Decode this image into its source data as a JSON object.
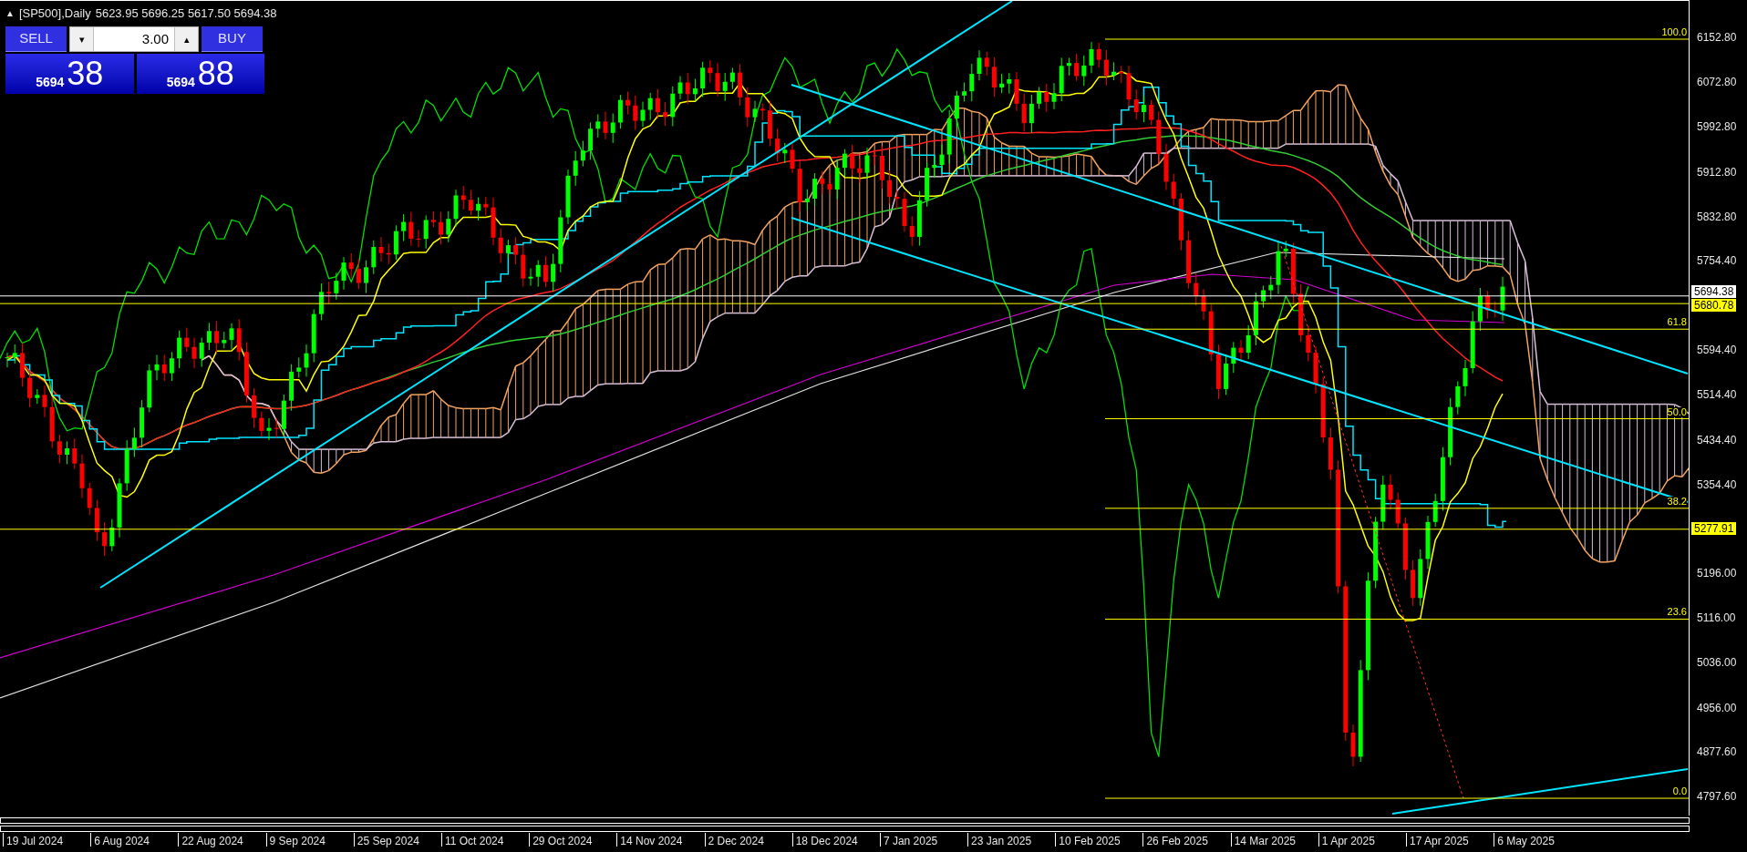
{
  "chart_header": {
    "collapse_glyph": "▲",
    "title": "[SP500],Daily",
    "ohlc": "5623.95 5696.25 5617.50 5694.38"
  },
  "trade_panel": {
    "sell_label": "SELL",
    "buy_label": "BUY",
    "volume": {
      "down_glyph": "▾",
      "value": "3.00",
      "up_glyph": "▴"
    },
    "sell_price": {
      "big_figure": "5694",
      "pips": "38"
    },
    "buy_price": {
      "big_figure": "5694",
      "pips": "88"
    }
  },
  "fibonacci_levels": [
    "100.0",
    "61.8",
    "50.0",
    "38.2",
    "23.6",
    "0.0"
  ],
  "price_axis": [
    "6152.80",
    "6072.80",
    "5992.80",
    "5912.80",
    "5832.80",
    "5754.40",
    "5594.40",
    "5514.40",
    "5434.40",
    "5354.40",
    "5196.00",
    "5116.00",
    "5036.00",
    "4956.00",
    "4877.60",
    "4797.60"
  ],
  "price_tags": [
    {
      "kind": "bid",
      "text": "5694.38"
    },
    {
      "kind": "line",
      "text": "5680.78"
    },
    {
      "kind": "line",
      "text": "5277.91"
    }
  ],
  "time_axis": [
    "19 Jul 2024",
    "6 Aug 2024",
    "22 Aug 2024",
    "9 Sep 2024",
    "25 Sep 2024",
    "11 Oct 2024",
    "29 Oct 2024",
    "14 Nov 2024",
    "2 Dec 2024",
    "18 Dec 2024",
    "7 Jan 2025",
    "23 Jan 2025",
    "10 Feb 2025",
    "26 Feb 2025",
    "14 Mar 2025",
    "1 Apr 2025",
    "17 Apr 2025",
    "6 May 2025"
  ]
}
